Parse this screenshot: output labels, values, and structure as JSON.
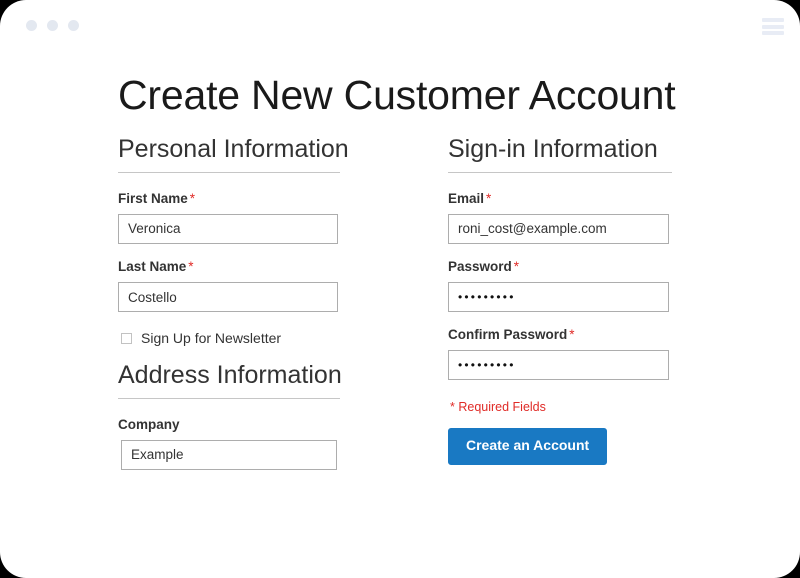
{
  "window": {
    "dots": [
      "dot-1",
      "dot-2",
      "dot-3"
    ],
    "menu_icon": "hamburger-menu-icon"
  },
  "page": {
    "title": "Create New Customer Account"
  },
  "sections": {
    "personal": {
      "legend": "Personal Information",
      "fields": [
        {
          "label": "First Name",
          "required": true,
          "required_mark": "*",
          "value": "Veronica",
          "placeholder": ""
        },
        {
          "label": "Last Name",
          "required": true,
          "required_mark": "*",
          "value": "Costello",
          "placeholder": ""
        }
      ],
      "newsletter": {
        "label": "Sign Up for Newsletter",
        "checked": false
      }
    },
    "address": {
      "legend": "Address Information",
      "fields": [
        {
          "label": "Company",
          "required": false,
          "required_mark": "",
          "value": "Example",
          "placeholder": ""
        }
      ]
    },
    "signin": {
      "legend": "Sign-in Information",
      "fields": [
        {
          "label": "Email",
          "required": true,
          "required_mark": "*",
          "value": "roni_cost@example.com",
          "placeholder": ""
        },
        {
          "label": "Password",
          "required": true,
          "required_mark": "*",
          "value": "•••••••••",
          "placeholder": ""
        },
        {
          "label": "Confirm Password",
          "required": true,
          "required_mark": "*",
          "value": "•••••••••",
          "placeholder": ""
        }
      ],
      "required_note": "* Required Fields",
      "submit_label": "Create an Account"
    }
  },
  "colors": {
    "accent_blue": "#1979c3",
    "required_red": "#e02b27",
    "input_border": "#adadad",
    "rule": "#c6c6c6",
    "dot": "#e3e8f0",
    "text": "#333333"
  }
}
